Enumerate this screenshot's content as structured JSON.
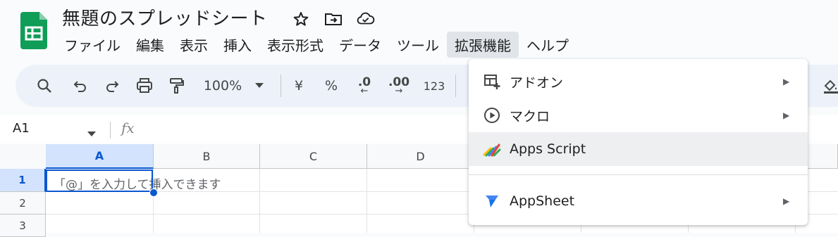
{
  "document": {
    "title": "無題のスプレッドシート"
  },
  "menubar": {
    "items": [
      "ファイル",
      "編集",
      "表示",
      "挿入",
      "表示形式",
      "データ",
      "ツール",
      "拡張機能",
      "ヘルプ"
    ],
    "active_index": 7
  },
  "toolbar": {
    "zoom": "100%",
    "currency": "¥",
    "percent": "%",
    "decimal_decrease": ".0",
    "decimal_increase": ".00",
    "number_format": "123"
  },
  "formula_bar": {
    "cell_ref": "A1",
    "fx": "fx"
  },
  "grid": {
    "columns": [
      "A",
      "B",
      "C",
      "D"
    ],
    "rows": [
      "1",
      "2",
      "3"
    ],
    "selected_cell": "A1",
    "cell_hint": "「@」を入力して挿入できます"
  },
  "extensions_menu": {
    "items": [
      {
        "label": "アドオン",
        "icon": "addon-icon",
        "submenu": true
      },
      {
        "label": "マクロ",
        "icon": "macro-play-icon",
        "submenu": true
      },
      {
        "label": "Apps Script",
        "icon": "apps-script-icon",
        "submenu": false,
        "hovered": true
      },
      {
        "label": "AppSheet",
        "icon": "appsheet-icon",
        "submenu": true
      }
    ]
  },
  "colors": {
    "accent": "#0b57d0",
    "sheets_green": "#0f9d58",
    "toolbar_bg": "#edf2fa"
  }
}
